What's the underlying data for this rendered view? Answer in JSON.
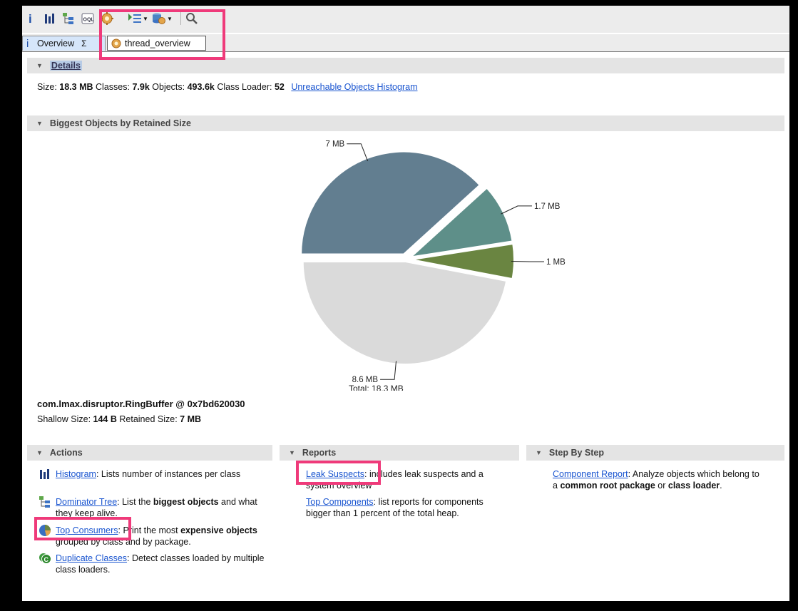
{
  "toolbar": {
    "icons": [
      "info-icon",
      "histogram-icon",
      "dominator-tree-icon",
      "oql-icon",
      "thread-overview-icon",
      "query-browser-icon",
      "dropdown-arrow-icon",
      "heap-dump-actions-icon",
      "dropdown-arrow-icon",
      "search-icon"
    ],
    "oql_text": "OQL"
  },
  "tabs": [
    {
      "label": "Overview",
      "icon": "info-icon",
      "active": true
    },
    {
      "label": "thread_overview",
      "icon": "thread-overview-icon",
      "active": false
    }
  ],
  "details": {
    "heading": "Details",
    "size_label": "Size:",
    "size_value": "18.3 MB",
    "classes_label": "Classes:",
    "classes_value": "7.9k",
    "objects_label": "Objects:",
    "objects_value": "493.6k",
    "loader_label": "Class Loader:",
    "loader_value": "52",
    "histogram_link": "Unreachable Objects Histogram"
  },
  "biggest": {
    "heading": "Biggest Objects by Retained Size",
    "object_name": "com.lmax.disruptor.RingBuffer @ 0x7bd620030",
    "shallow_label": "Shallow Size:",
    "shallow_value": "144 B",
    "retained_label": "Retained Size:",
    "retained_value": "7 MB"
  },
  "chart_data": {
    "type": "pie",
    "slices": [
      {
        "label": "7 MB",
        "value": 7,
        "color": "#627e90",
        "exploded": true
      },
      {
        "label": "1.7 MB",
        "value": 1.7,
        "color": "#5e8f89",
        "exploded": true
      },
      {
        "label": "1 MB",
        "value": 1,
        "color": "#6a8541",
        "exploded": true
      },
      {
        "label": "8.6 MB",
        "value": 8.6,
        "color": "#dadada",
        "exploded": false
      }
    ],
    "total_label": "Total: 18.3 MB"
  },
  "actions": {
    "heading": "Actions",
    "items": [
      {
        "link": "Histogram",
        "rest": ": Lists number of instances per class",
        "icon": "histogram-icon"
      },
      {
        "link": "Dominator Tree",
        "pre": ": List the ",
        "bold": "biggest objects",
        "post": " and what they keep alive.",
        "icon": "dominator-tree-icon"
      },
      {
        "link": "Top Consumers",
        "pre": ": Print the most ",
        "bold": "expensive objects",
        "post": " grouped by class and by package.",
        "icon": "top-consumers-icon"
      },
      {
        "link": "Duplicate Classes",
        "rest": ": Detect classes loaded by multiple class loaders.",
        "icon": "duplicate-classes-icon"
      }
    ]
  },
  "reports": {
    "heading": "Reports",
    "items": [
      {
        "link": "Leak Suspects",
        "rest": ": includes leak suspects and a system overview"
      },
      {
        "link": "Top Components",
        "rest": ": list reports for components bigger than 1 percent of the total heap."
      }
    ]
  },
  "steps": {
    "heading": "Step By Step",
    "link": "Component Report",
    "pre": ": Analyze objects which belong to a ",
    "bold1": "common root package",
    "mid": " or ",
    "bold2": "class loader",
    "post": "."
  },
  "colors": {
    "highlight": "#ef3a7a",
    "link": "#1a55d0",
    "section_bg": "#e4e4e4"
  }
}
